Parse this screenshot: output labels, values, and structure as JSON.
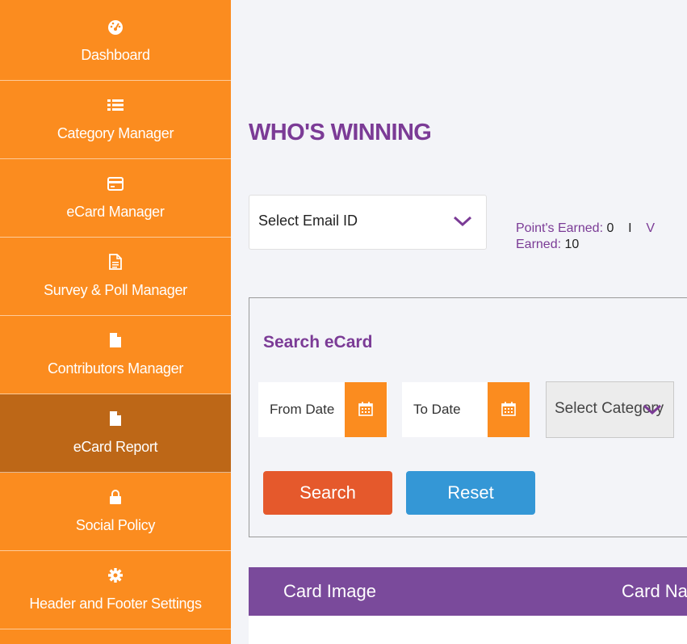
{
  "sidebar": {
    "items": [
      {
        "label": "Dashboard",
        "icon": "dashboard-icon"
      },
      {
        "label": "Category Manager",
        "icon": "list-icon"
      },
      {
        "label": "eCard Manager",
        "icon": "card-icon"
      },
      {
        "label": "Survey & Poll Manager",
        "icon": "document-icon"
      },
      {
        "label": "Contributors Manager",
        "icon": "file-icon"
      },
      {
        "label": "eCard Report",
        "icon": "file-icon",
        "active": true
      },
      {
        "label": "Social Policy",
        "icon": "lock-icon"
      },
      {
        "label": "Header and Footer Settings",
        "icon": "gear-icon"
      }
    ]
  },
  "main": {
    "title": "WHO'S WINNING",
    "email_select": {
      "value": "Select Email ID"
    },
    "points": {
      "earned_label": "Point's Earned:",
      "earned_value": "0",
      "separator": "I",
      "second_label_partial": "V",
      "earned2_label": "Earned:",
      "earned2_value": "10"
    },
    "search": {
      "title": "Search eCard",
      "from_date_placeholder": "From Date",
      "to_date_placeholder": "To Date",
      "category_select": "Select Category",
      "search_button": "Search",
      "reset_button": "Reset"
    },
    "table": {
      "columns": [
        "Card Image",
        "Card Na"
      ]
    }
  },
  "colors": {
    "sidebar": "#fb8c1f",
    "sidebar_active": "#bd6717",
    "accent_purple": "#7b3b96",
    "search_btn": "#e5592c",
    "reset_btn": "#3497d6"
  }
}
